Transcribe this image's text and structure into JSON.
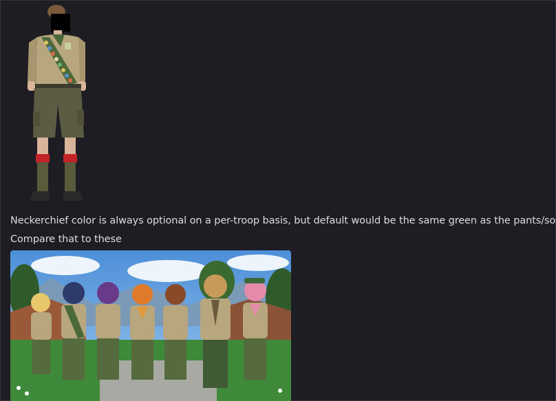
{
  "messages": [
    {
      "text": "Neckerchief color is always optional on a per-troop basis, but default would be the same green as the pants/socks"
    },
    {
      "text": "Compare that to these"
    }
  ],
  "attachments": [
    {
      "icon": "image-icon",
      "kind": "photo"
    },
    {
      "icon": "image-icon",
      "kind": "illustration"
    }
  ],
  "colors": {
    "background": "#1e1d24",
    "text": "#dcdde1",
    "shirt": "#b8a67e",
    "shorts": "#5c5c44",
    "socks": "#c4232a"
  }
}
